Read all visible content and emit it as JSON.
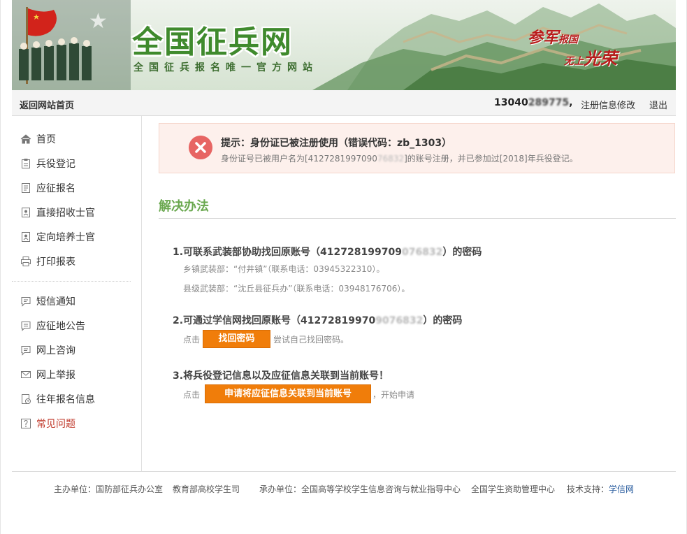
{
  "banner": {
    "logo": "全国征兵网",
    "subtitle": "全国征兵报名唯一官方网站",
    "slogan_a": "参军",
    "slogan_a_small": "报国",
    "slogan_b_small": "无上",
    "slogan_b": "光荣"
  },
  "topbar": {
    "home": "返回网站首页",
    "username_prefix": "13040",
    "username_masked": "289775",
    "username_suffix": ",",
    "edit": "注册信息修改",
    "logout": "退出"
  },
  "sidebar": {
    "items": [
      {
        "label": "首页",
        "icon": "home-icon"
      },
      {
        "label": "兵役登记",
        "icon": "clipboard-icon"
      },
      {
        "label": "应征报名",
        "icon": "document-icon"
      },
      {
        "label": "直接招收士官",
        "icon": "id-card-icon"
      },
      {
        "label": "定向培养士官",
        "icon": "id-card-icon"
      },
      {
        "label": "打印报表",
        "icon": "printer-icon"
      },
      {
        "label": "短信通知",
        "icon": "message-icon"
      },
      {
        "label": "应征地公告",
        "icon": "announcement-icon"
      },
      {
        "label": "网上咨询",
        "icon": "chat-icon"
      },
      {
        "label": "网上举报",
        "icon": "mail-icon"
      },
      {
        "label": "往年报名信息",
        "icon": "history-icon"
      },
      {
        "label": "常见问题",
        "icon": "question-icon"
      }
    ]
  },
  "alert": {
    "title": "提示：身份证已被注册使用（错误代码：zb_1303）",
    "desc_prefix": "身份证号已被用户名为[4127281997090",
    "desc_masked": "76832",
    "desc_suffix": "]的账号注册，并已参加过[2018]年兵役登记。"
  },
  "solution": {
    "title": "解决办法",
    "step1_prefix": "1.可联系武装部协助找回原账号（412728199709",
    "step1_masked": "076832",
    "step1_suffix": "）的密码",
    "step1_town": "乡镇武装部：“付井镇”（联系电话：03945322310）。",
    "step1_county": "县级武装部：“沈丘县征兵办”（联系电话：03948176706）。",
    "step2_prefix": "2.可通过学信网找回原账号（41272819970",
    "step2_masked": "9076832",
    "step2_suffix": "）的密码",
    "step2_click": "点击",
    "step2_button": "找回密码",
    "step2_after": "尝试自己找回密码。",
    "step3_title": "3.将兵役登记信息以及应征信息关联到当前账号！",
    "step3_click": "点击",
    "step3_button": "申请将应征信息关联到当前账号",
    "step3_after": "，开始申请"
  },
  "footer": {
    "host_label": "主办单位：",
    "host1": "国防部征兵办公室",
    "host2": "教育部高校学生司",
    "org_label": "承办单位：",
    "org1": "全国高等学校学生信息咨询与就业指导中心",
    "org2": "全国学生资助管理中心",
    "tech_label": "技术支持：",
    "tech": "学信网"
  },
  "colors": {
    "accent_green": "#6aa84f",
    "button_orange": "#f07d0a",
    "alert_bg": "#fdf0ec",
    "error_red": "#e76563"
  }
}
